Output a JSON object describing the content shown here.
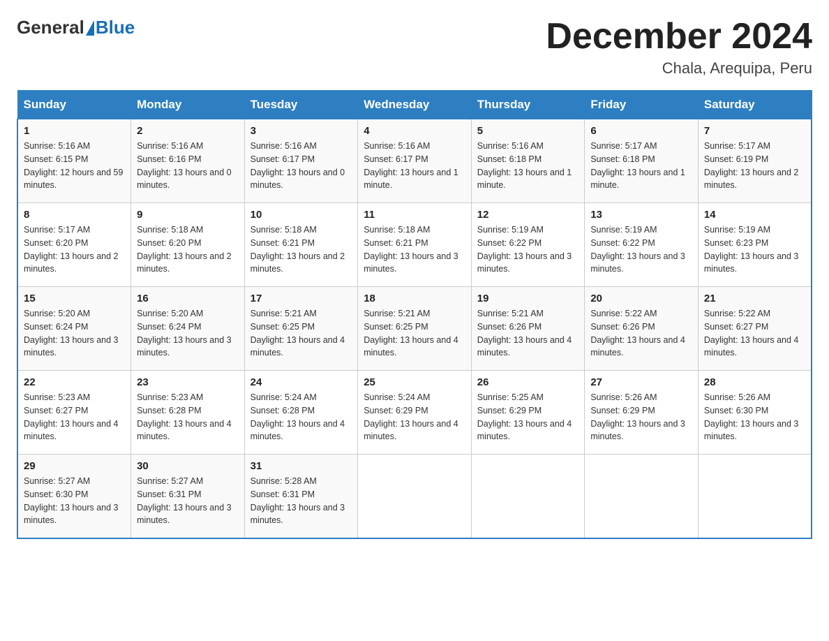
{
  "header": {
    "logo_general": "General",
    "logo_blue": "Blue",
    "calendar_title": "December 2024",
    "calendar_subtitle": "Chala, Arequipa, Peru"
  },
  "days_of_week": [
    "Sunday",
    "Monday",
    "Tuesday",
    "Wednesday",
    "Thursday",
    "Friday",
    "Saturday"
  ],
  "weeks": [
    [
      {
        "day": "1",
        "sunrise": "5:16 AM",
        "sunset": "6:15 PM",
        "daylight": "12 hours and 59 minutes."
      },
      {
        "day": "2",
        "sunrise": "5:16 AM",
        "sunset": "6:16 PM",
        "daylight": "13 hours and 0 minutes."
      },
      {
        "day": "3",
        "sunrise": "5:16 AM",
        "sunset": "6:17 PM",
        "daylight": "13 hours and 0 minutes."
      },
      {
        "day": "4",
        "sunrise": "5:16 AM",
        "sunset": "6:17 PM",
        "daylight": "13 hours and 1 minute."
      },
      {
        "day": "5",
        "sunrise": "5:16 AM",
        "sunset": "6:18 PM",
        "daylight": "13 hours and 1 minute."
      },
      {
        "day": "6",
        "sunrise": "5:17 AM",
        "sunset": "6:18 PM",
        "daylight": "13 hours and 1 minute."
      },
      {
        "day": "7",
        "sunrise": "5:17 AM",
        "sunset": "6:19 PM",
        "daylight": "13 hours and 2 minutes."
      }
    ],
    [
      {
        "day": "8",
        "sunrise": "5:17 AM",
        "sunset": "6:20 PM",
        "daylight": "13 hours and 2 minutes."
      },
      {
        "day": "9",
        "sunrise": "5:18 AM",
        "sunset": "6:20 PM",
        "daylight": "13 hours and 2 minutes."
      },
      {
        "day": "10",
        "sunrise": "5:18 AM",
        "sunset": "6:21 PM",
        "daylight": "13 hours and 2 minutes."
      },
      {
        "day": "11",
        "sunrise": "5:18 AM",
        "sunset": "6:21 PM",
        "daylight": "13 hours and 3 minutes."
      },
      {
        "day": "12",
        "sunrise": "5:19 AM",
        "sunset": "6:22 PM",
        "daylight": "13 hours and 3 minutes."
      },
      {
        "day": "13",
        "sunrise": "5:19 AM",
        "sunset": "6:22 PM",
        "daylight": "13 hours and 3 minutes."
      },
      {
        "day": "14",
        "sunrise": "5:19 AM",
        "sunset": "6:23 PM",
        "daylight": "13 hours and 3 minutes."
      }
    ],
    [
      {
        "day": "15",
        "sunrise": "5:20 AM",
        "sunset": "6:24 PM",
        "daylight": "13 hours and 3 minutes."
      },
      {
        "day": "16",
        "sunrise": "5:20 AM",
        "sunset": "6:24 PM",
        "daylight": "13 hours and 3 minutes."
      },
      {
        "day": "17",
        "sunrise": "5:21 AM",
        "sunset": "6:25 PM",
        "daylight": "13 hours and 4 minutes."
      },
      {
        "day": "18",
        "sunrise": "5:21 AM",
        "sunset": "6:25 PM",
        "daylight": "13 hours and 4 minutes."
      },
      {
        "day": "19",
        "sunrise": "5:21 AM",
        "sunset": "6:26 PM",
        "daylight": "13 hours and 4 minutes."
      },
      {
        "day": "20",
        "sunrise": "5:22 AM",
        "sunset": "6:26 PM",
        "daylight": "13 hours and 4 minutes."
      },
      {
        "day": "21",
        "sunrise": "5:22 AM",
        "sunset": "6:27 PM",
        "daylight": "13 hours and 4 minutes."
      }
    ],
    [
      {
        "day": "22",
        "sunrise": "5:23 AM",
        "sunset": "6:27 PM",
        "daylight": "13 hours and 4 minutes."
      },
      {
        "day": "23",
        "sunrise": "5:23 AM",
        "sunset": "6:28 PM",
        "daylight": "13 hours and 4 minutes."
      },
      {
        "day": "24",
        "sunrise": "5:24 AM",
        "sunset": "6:28 PM",
        "daylight": "13 hours and 4 minutes."
      },
      {
        "day": "25",
        "sunrise": "5:24 AM",
        "sunset": "6:29 PM",
        "daylight": "13 hours and 4 minutes."
      },
      {
        "day": "26",
        "sunrise": "5:25 AM",
        "sunset": "6:29 PM",
        "daylight": "13 hours and 4 minutes."
      },
      {
        "day": "27",
        "sunrise": "5:26 AM",
        "sunset": "6:29 PM",
        "daylight": "13 hours and 3 minutes."
      },
      {
        "day": "28",
        "sunrise": "5:26 AM",
        "sunset": "6:30 PM",
        "daylight": "13 hours and 3 minutes."
      }
    ],
    [
      {
        "day": "29",
        "sunrise": "5:27 AM",
        "sunset": "6:30 PM",
        "daylight": "13 hours and 3 minutes."
      },
      {
        "day": "30",
        "sunrise": "5:27 AM",
        "sunset": "6:31 PM",
        "daylight": "13 hours and 3 minutes."
      },
      {
        "day": "31",
        "sunrise": "5:28 AM",
        "sunset": "6:31 PM",
        "daylight": "13 hours and 3 minutes."
      },
      null,
      null,
      null,
      null
    ]
  ]
}
